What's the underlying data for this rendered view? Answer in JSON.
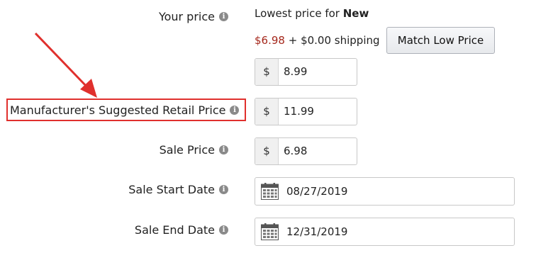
{
  "your_price": {
    "label": "Your price",
    "lowest_prefix": "Lowest price for",
    "lowest_condition": "New",
    "lowest_price": "$6.98",
    "shipping_text": "+ $0.00 shipping",
    "match_button": "Match Low Price",
    "currency": "$",
    "value": "8.99"
  },
  "msrp": {
    "label": "Manufacturer's Suggested Retail Price",
    "currency": "$",
    "value": "11.99"
  },
  "sale_price": {
    "label": "Sale Price",
    "currency": "$",
    "value": "6.98"
  },
  "sale_start": {
    "label": "Sale Start Date",
    "value": "08/27/2019"
  },
  "sale_end": {
    "label": "Sale End Date",
    "value": "12/31/2019"
  },
  "info_icon_glyph": "i",
  "colors": {
    "lowest_price": "#a5281c",
    "highlight_box": "#e0302d",
    "arrow": "#e0302d"
  }
}
